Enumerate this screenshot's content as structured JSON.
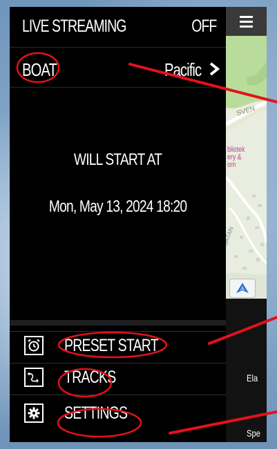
{
  "live_streaming": {
    "label": "LIVE STREAMING",
    "status": "OFF"
  },
  "boat": {
    "label": "BOAT",
    "timezone": "Pacific"
  },
  "start": {
    "label": "WILL START AT",
    "datetime": "Mon, May 13, 2024 18:20"
  },
  "menu": [
    {
      "label": "PRESET START",
      "icon": "alarm-clock-icon"
    },
    {
      "label": "TRACKS",
      "icon": "track-path-icon"
    },
    {
      "label": "SETTINGS",
      "icon": "gear-icon"
    }
  ],
  "map_labels": {
    "street_top": "SVEN",
    "poi_lines": [
      "bliotek",
      "ery &",
      "om"
    ],
    "street_side": "GATAN"
  },
  "right_panel": {
    "label_1": "Ela",
    "label_2": "Spe"
  },
  "colors": {
    "annotation": "#e4111a",
    "background": "#000000",
    "text": "#ffffff",
    "map_green": "#b8d99a"
  }
}
